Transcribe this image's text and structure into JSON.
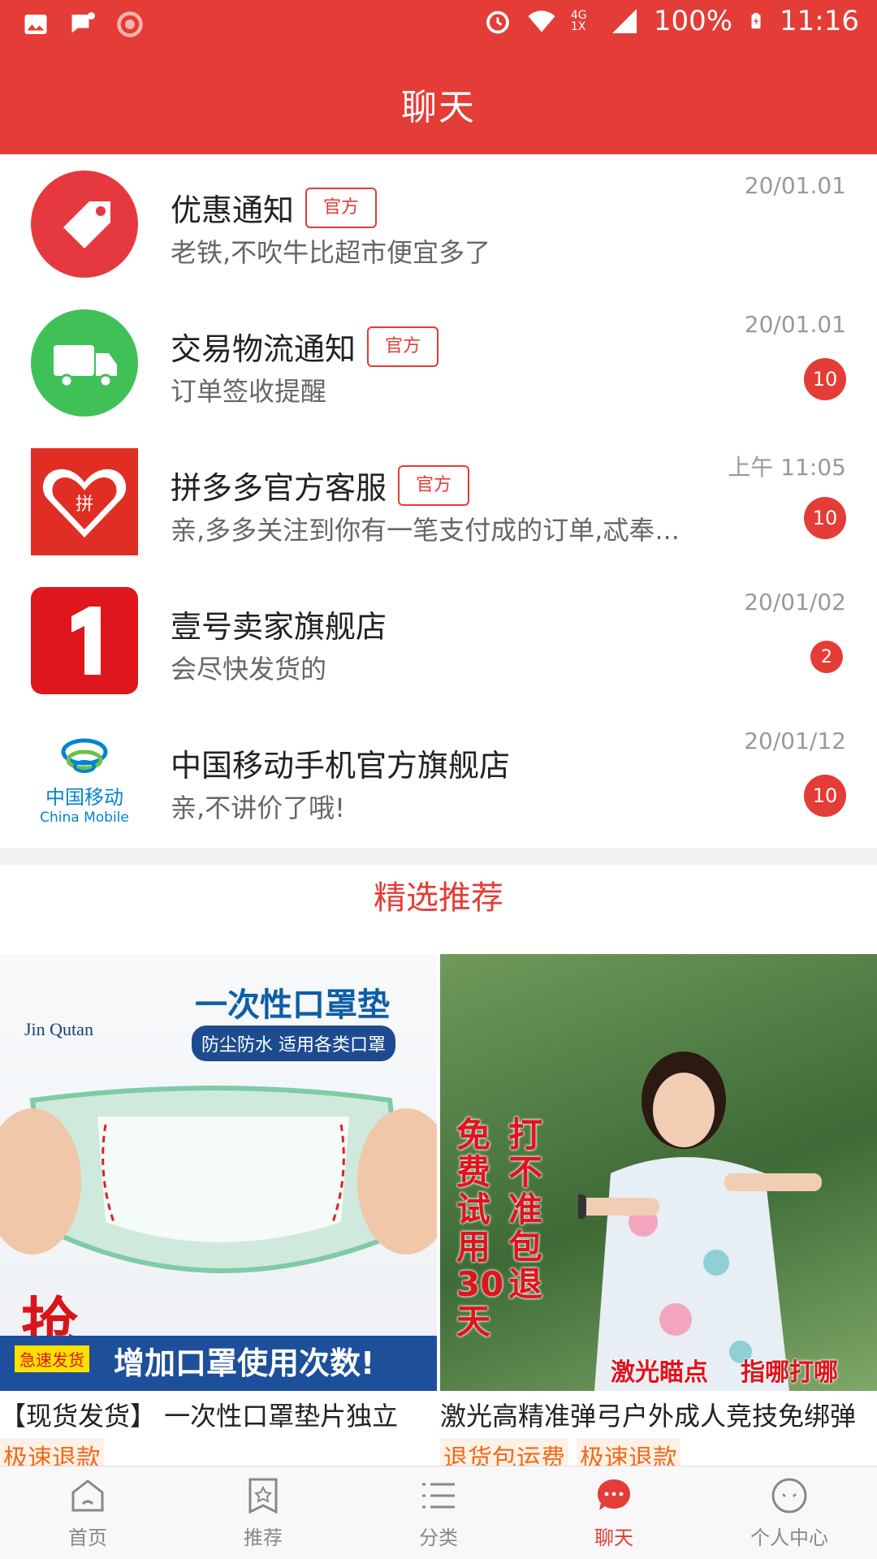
{
  "status_bar": {
    "battery": "100%",
    "time": "11:16",
    "network": "4G 1X",
    "icons": [
      "image-icon",
      "message-icon",
      "app-icon",
      "alarm-icon",
      "wifi-icon",
      "signal-icon",
      "battery-icon"
    ]
  },
  "header": {
    "title": "聊天"
  },
  "chats": [
    {
      "title": "优惠通知",
      "tag": "官方",
      "subtitle": "老铁,不吹牛比超市便宜多了",
      "time": "20/01.01",
      "badge": "",
      "avatar": "coupon-tag-icon",
      "color": "#e6393f"
    },
    {
      "title": "交易物流通知",
      "tag": "官方",
      "subtitle": "订单签收提醒",
      "time": "20/01.01",
      "badge": "10",
      "avatar": "truck-icon",
      "color": "#3fc158"
    },
    {
      "title": "拼多多官方客服",
      "tag": "官方",
      "subtitle": "亲,多多关注到你有一笔支付成的订单,忒奉...",
      "time": "上午 11:05",
      "badge": "10",
      "avatar": "pinduoduo-logo",
      "color": "#e02e24"
    },
    {
      "title": "壹号卖家旗舰店",
      "tag": "",
      "subtitle": "会尽快发货的",
      "time": "20/01/02",
      "badge": "2",
      "avatar": "number-one-logo",
      "color": "#e0161d"
    },
    {
      "title": "中国移动手机官方旗舰店",
      "tag": "",
      "subtitle": "亲,不讲价了哦!",
      "time": "20/01/12",
      "badge": "10",
      "avatar": "china-mobile-logo",
      "color": "#0085d0"
    }
  ],
  "china_mobile_logo": {
    "cn": "中国移动",
    "en": "China Mobile"
  },
  "recommend": {
    "title": "精选推荐",
    "items": [
      {
        "name": "【现货发货】 一次性口罩垫片独立",
        "tags": [
          "极速退款"
        ],
        "img": {
          "brand": "Jin Qutan",
          "headline": "一次性口罩垫",
          "sub": "防尘防水 适用各类口罩",
          "grab": "抢",
          "ship": "急速发货",
          "banner": "增加口罩使用次数!"
        }
      },
      {
        "name": "激光高精准弹弓户外成人竞技免绑弹",
        "tags": [
          "退货包运费",
          "极速退款"
        ],
        "img": {
          "left_text": "免费试用30天",
          "right_text": "打不准包退",
          "bottom_left": "激光瞄点",
          "bottom_right": "指哪打哪"
        }
      }
    ]
  },
  "nav": [
    {
      "label": "首页",
      "icon": "home-icon",
      "active": false
    },
    {
      "label": "推荐",
      "icon": "star-bookmark-icon",
      "active": false
    },
    {
      "label": "分类",
      "icon": "list-icon",
      "active": false
    },
    {
      "label": "聊天",
      "icon": "chat-bubble-icon",
      "active": true
    },
    {
      "label": "个人中心",
      "icon": "profile-face-icon",
      "active": false
    }
  ],
  "colors": {
    "primary": "#e43c36",
    "accent_orange": "#f26a1b"
  }
}
